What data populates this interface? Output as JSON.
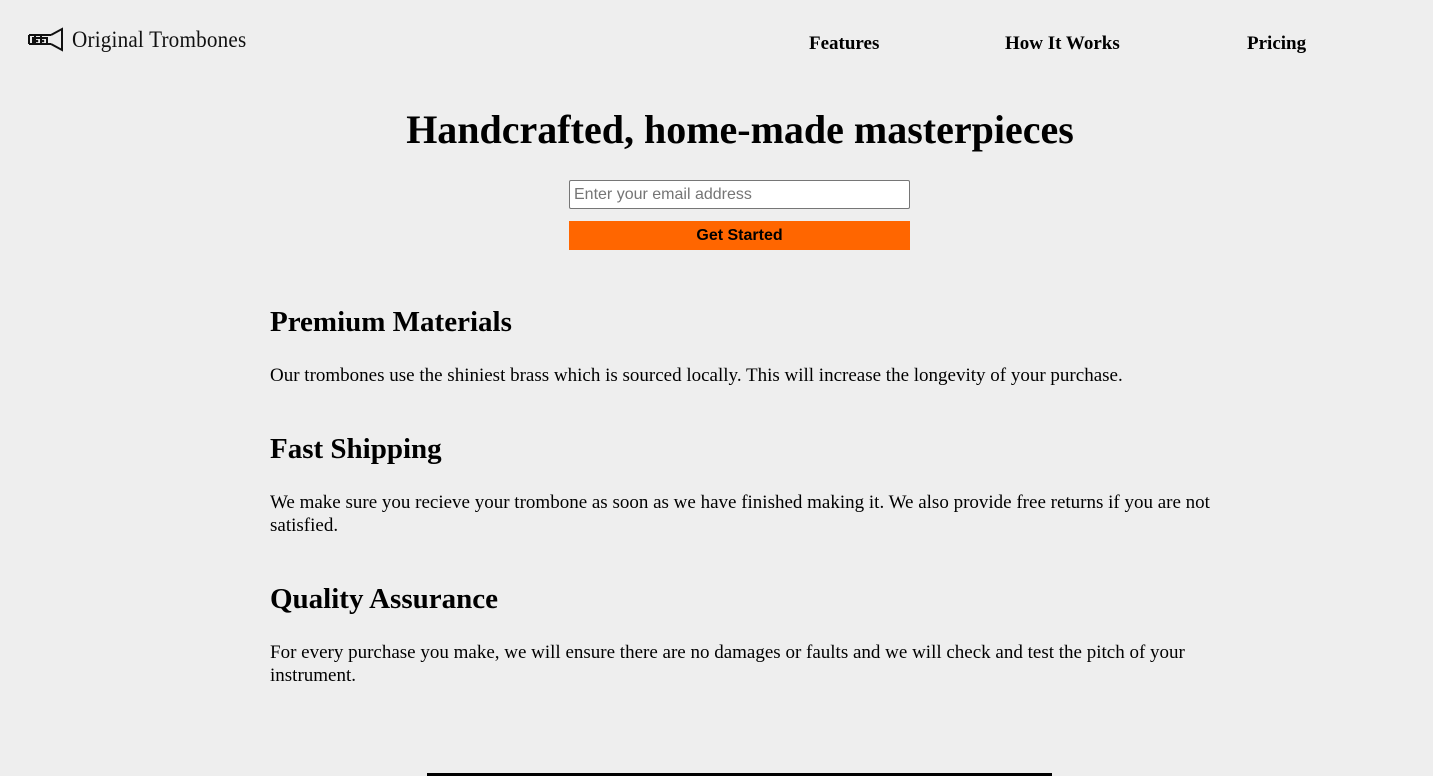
{
  "header": {
    "logo_text": "Original Trombones",
    "logo_icon": "trombone-icon",
    "nav": [
      {
        "label": "Features"
      },
      {
        "label": "How It Works"
      },
      {
        "label": "Pricing"
      }
    ]
  },
  "hero": {
    "title": "Handcrafted, home-made masterpieces",
    "email_placeholder": "Enter your email address",
    "email_value": "",
    "cta_label": "Get Started",
    "cta_color": "#ff6600"
  },
  "features": [
    {
      "title": "Premium Materials",
      "description": "Our trombones use the shiniest brass which is sourced locally. This will increase the longevity of your purchase."
    },
    {
      "title": "Fast Shipping",
      "description": "We make sure you recieve your trombone as soon as we have finished making it. We also provide free returns if you are not satisfied."
    },
    {
      "title": "Quality Assurance",
      "description": "For every purchase you make, we will ensure there are no damages or faults and we will check and test the pitch of your instrument."
    }
  ],
  "colors": {
    "background": "#eeeeee",
    "accent": "#ff6600",
    "text": "#000000"
  }
}
